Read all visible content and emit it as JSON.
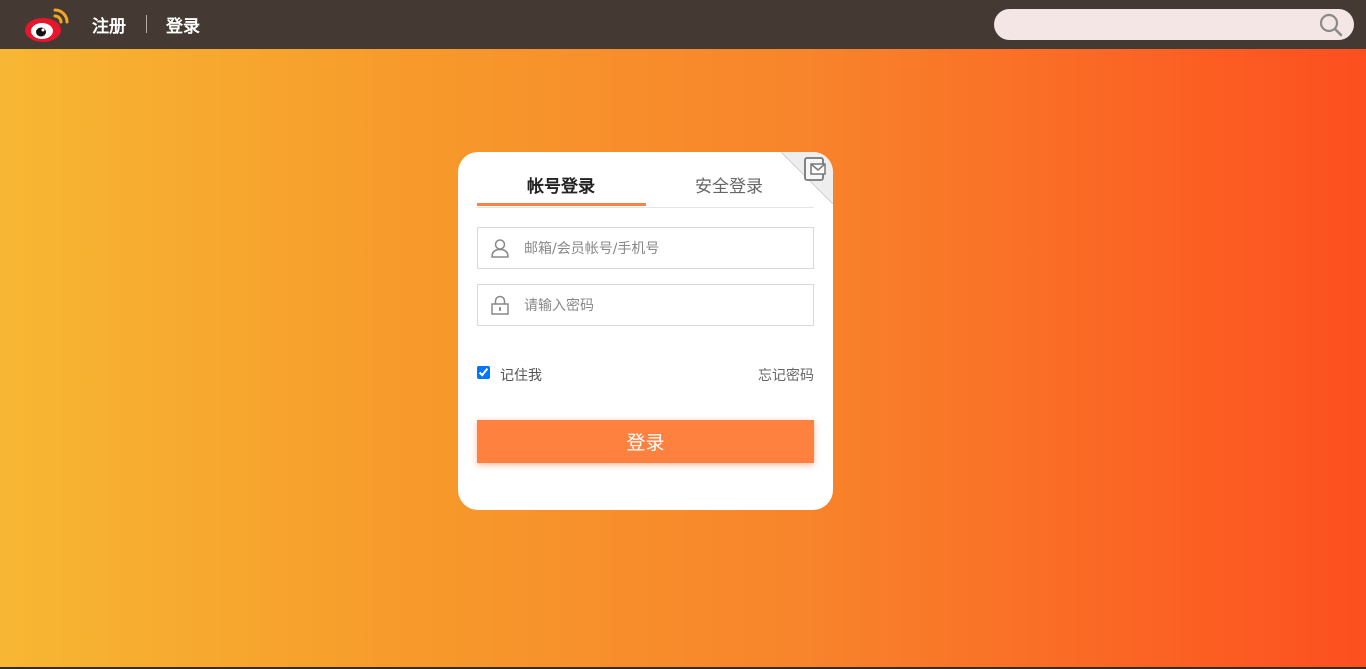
{
  "header": {
    "logo_icon": "weibo-logo-icon",
    "register_label": "注册",
    "login_label": "登录",
    "search": {
      "placeholder": "",
      "icon": "search-icon"
    }
  },
  "login_card": {
    "corner_icon": "qr-code-switch-icon",
    "tabs": [
      {
        "label": "帐号登录",
        "active": true
      },
      {
        "label": "安全登录",
        "active": false
      }
    ],
    "username": {
      "icon": "user-icon",
      "placeholder": "邮箱/会员帐号/手机号",
      "value": ""
    },
    "password": {
      "icon": "lock-icon",
      "placeholder": "请输入密码",
      "value": ""
    },
    "remember_me": {
      "label": "记住我",
      "checked": true
    },
    "forgot_password_label": "忘记密码",
    "submit_label": "登录"
  },
  "colors": {
    "accent": "#ff8140",
    "topbar": "#443a33",
    "gradient_start": "#f7b733",
    "gradient_end": "#fd4f1f"
  }
}
